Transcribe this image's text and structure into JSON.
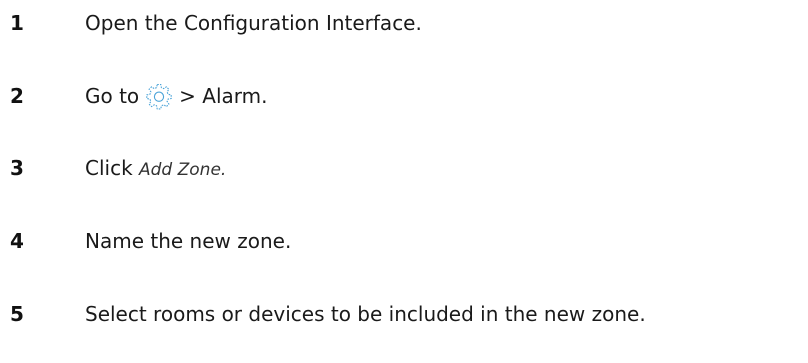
{
  "steps": [
    {
      "number": "1",
      "text": "Open the Configuration Interface."
    },
    {
      "number": "2",
      "text_before": "Go to",
      "icon": "gear-icon",
      "text_after": "> Alarm."
    },
    {
      "number": "3",
      "text": "Click",
      "emphasis": "Add Zone."
    },
    {
      "number": "4",
      "text": "Name the new zone."
    },
    {
      "number": "5",
      "text": "Select rooms or devices to be included in the new zone."
    }
  ],
  "colors": {
    "text": "#1a1a1a",
    "number": "#111111",
    "icon_stroke": "#4aa3d8"
  }
}
